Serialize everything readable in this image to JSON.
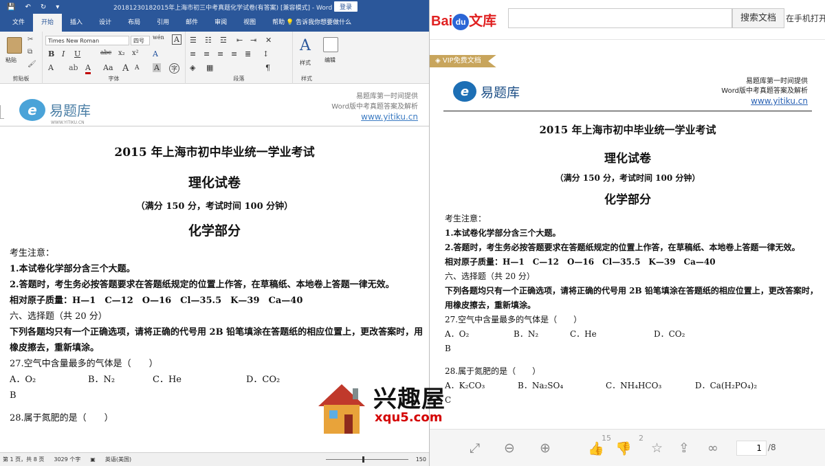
{
  "word": {
    "window_title": "20181230182015年上海市初三中考真题化学试卷(有答案) [兼容模式] - Word",
    "login_label": "登录",
    "quick_access": [
      "save-icon",
      "undo-icon",
      "redo-icon",
      "customize-icon"
    ],
    "tabs": [
      "文件",
      "开始",
      "插入",
      "设计",
      "布局",
      "引用",
      "邮件",
      "审阅",
      "视图",
      "帮助"
    ],
    "active_tab": "开始",
    "tell_me": "告诉我你想要做什么",
    "ribbon": {
      "clipboard_label": "剪贴板",
      "paste_label": "粘贴",
      "font_group_label": "字体",
      "paragraph_group_label": "段落",
      "styles_group_label": "样式",
      "font_name": "Times New Roman",
      "font_size": "四号",
      "style_button_label": "样式",
      "edit_button_label": "编辑"
    },
    "header": {
      "logo_letter": "e",
      "logo_text": "易题库",
      "logo_url": "WWW.YITIKU.CN",
      "promo_line1": "易题库第一时间提供",
      "promo_line2": "Word版中考真题答案及解析",
      "promo_link": "www.yitiku.cn"
    },
    "doc": {
      "title": "2015 年上海市初中毕业统一学业考试",
      "subtitle": "理化试卷",
      "score_line": "（满分 150 分，考试时间 100 分钟）",
      "section": "化学部分",
      "notice_heading": "考生注意：",
      "notice_1": "1.本试卷化学部分含三个大题。",
      "notice_2": "2.答题时，考生务必按答题要求在答题纸规定的位置上作答，在草稿纸、本地卷上答题一律无效。",
      "atomic_masses": "相对原子质量：H—1　C—12　O—16　Cl—35.5　K—39　Ca—40",
      "part6": "六、选择题（共 20 分）",
      "part6_instr": "下列各题均只有一个正确选项，请将正确的代号用 2B 铅笔填涂在答题纸的相应位置上，更改答案时，用橡皮擦去，重新填涂。",
      "q27": "27.空气中含量最多的气体是（　　）",
      "q27_options": [
        "A．O₂",
        "B．N₂",
        "C．He",
        "D．CO₂"
      ],
      "q27_answer": "B",
      "q28": "28.属于氮肥的是（　　）"
    },
    "status": {
      "page_info": "第 1 页，共 8 页",
      "word_count": "3029 个字",
      "language": "英语(美国)",
      "zoom": "150"
    }
  },
  "baidu": {
    "logo_bai": "Bai",
    "logo_du": "du",
    "logo_wenku": "文库",
    "search_placeholder": "",
    "search_button": "搜索文档",
    "phone_link": "在手机打开",
    "vip_badge": "VIP免费文档",
    "header": {
      "logo_letter": "e",
      "logo_text": "易题库",
      "logo_url": "WWW.YITIKU.CN",
      "promo_line1": "易题库第一时间提供",
      "promo_line2": "Word版中考真题答案及解析",
      "promo_link": "www.yitiku.cn"
    },
    "doc": {
      "title": "2015 年上海市初中毕业统一学业考试",
      "subtitle": "理化试卷",
      "score_line": "（满分 150 分，考试时间 100 分钟）",
      "section": "化学部分",
      "notice_heading": "考生注意：",
      "notice_1": "1.本试卷化学部分含三个大题。",
      "notice_2": "2.答题时，考生务必按答题要求在答题纸规定的位置上作答，在草稿纸、本地卷上答题一律无效。",
      "atomic_masses": "相对原子质量：H—1　C—12　O—16　Cl—35.5　K—39　Ca—40",
      "part6": "六、选择题（共 20 分）",
      "part6_instr": "下列各题均只有一个正确选项，请将正确的代号用 2B 铅笔填涂在答题纸的相应位置上，更改答案时，用橡皮擦去，重新填涂。",
      "q27": "27.空气中含量最多的气体是（　　）",
      "q27_options": [
        "A．O₂",
        "B．N₂",
        "C．He",
        "D．CO₂"
      ],
      "q27_answer": "B",
      "q28": "28.属于氮肥的是（　　）",
      "q28_options": [
        "A．K₂CO₃",
        "B．Na₂SO₄",
        "C．NH₄HCO₃",
        "D．Ca(H₂PO₄)₂"
      ],
      "q28_answer": "C"
    },
    "footer": {
      "like_count": "15",
      "dislike_count": "2",
      "page_current": "1",
      "page_total": "/8"
    }
  },
  "watermark": {
    "brand": "兴趣屋",
    "url": "xqu5.com"
  },
  "colors": {
    "word_blue": "#2b579a",
    "baidu_red": "#e02020",
    "baidu_blue": "#2b66d6",
    "vip_gold": "#c8a55c",
    "watermark_red": "#d40000"
  }
}
